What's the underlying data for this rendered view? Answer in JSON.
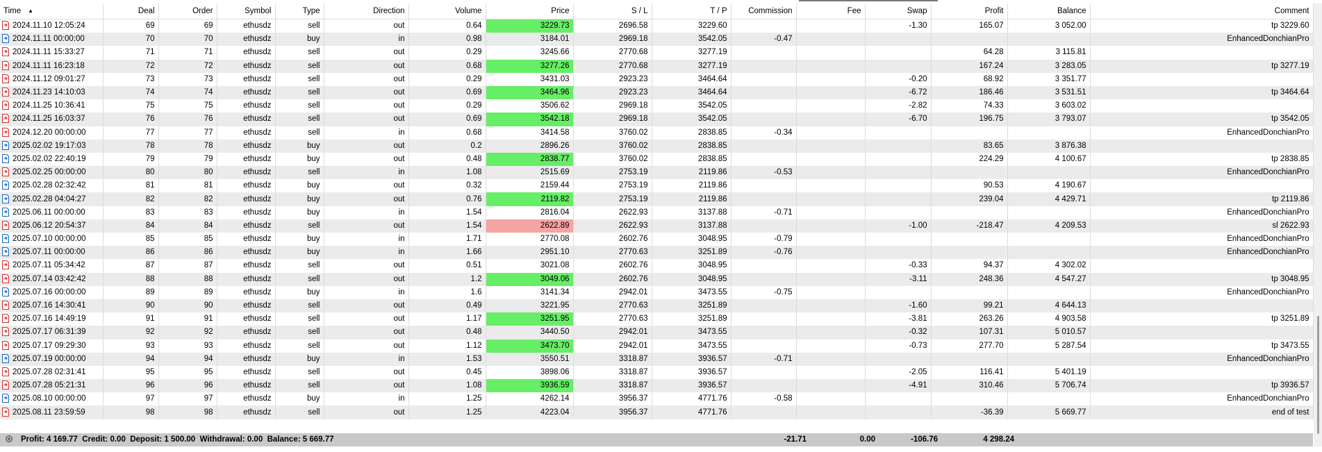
{
  "columns": [
    {
      "label": "Time",
      "w": 148,
      "align": "left"
    },
    {
      "label": "Deal",
      "w": 80
    },
    {
      "label": "Order",
      "w": 84
    },
    {
      "label": "Symbol",
      "w": 84
    },
    {
      "label": "Type",
      "w": 70
    },
    {
      "label": "Direction",
      "w": 122
    },
    {
      "label": "Volume",
      "w": 111
    },
    {
      "label": "Price",
      "w": 126
    },
    {
      "label": "S / L",
      "w": 113
    },
    {
      "label": "T / P",
      "w": 114
    },
    {
      "label": "Commission",
      "w": 94
    },
    {
      "label": "Fee",
      "w": 99
    },
    {
      "label": "Swap",
      "w": 95
    },
    {
      "label": "Profit",
      "w": 110
    },
    {
      "label": "Balance",
      "w": 119
    },
    {
      "label": "Comment",
      "w": 321
    }
  ],
  "rows": [
    {
      "icon": "sell",
      "time": "2024.11.10 12:05:24",
      "deal": "69",
      "order": "69",
      "symbol": "ethusdz",
      "type": "sell",
      "direction": "out",
      "volume": "0.64",
      "price": "3229.73",
      "price_hl": "green",
      "sl": "2696.58",
      "tp": "3229.60",
      "commission": "",
      "fee": "",
      "swap": "-1.30",
      "profit": "165.07",
      "balance": "3 052.00",
      "comment": "tp 3229.60"
    },
    {
      "icon": "buy",
      "time": "2024.11.11 00:00:00",
      "deal": "70",
      "order": "70",
      "symbol": "ethusdz",
      "type": "buy",
      "direction": "in",
      "volume": "0.98",
      "price": "3184.01",
      "price_hl": "",
      "sl": "2969.18",
      "tp": "3542.05",
      "commission": "-0.47",
      "fee": "",
      "swap": "",
      "profit": "",
      "balance": "",
      "comment": "EnhancedDonchianPro"
    },
    {
      "icon": "sell",
      "time": "2024.11.11 15:33:27",
      "deal": "71",
      "order": "71",
      "symbol": "ethusdz",
      "type": "sell",
      "direction": "out",
      "volume": "0.29",
      "price": "3245.66",
      "price_hl": "",
      "sl": "2770.68",
      "tp": "3277.19",
      "commission": "",
      "fee": "",
      "swap": "",
      "profit": "64.28",
      "balance": "3 115.81",
      "comment": ""
    },
    {
      "icon": "sell",
      "time": "2024.11.11 16:23:18",
      "deal": "72",
      "order": "72",
      "symbol": "ethusdz",
      "type": "sell",
      "direction": "out",
      "volume": "0.68",
      "price": "3277.26",
      "price_hl": "green",
      "sl": "2770.68",
      "tp": "3277.19",
      "commission": "",
      "fee": "",
      "swap": "",
      "profit": "167.24",
      "balance": "3 283.05",
      "comment": "tp 3277.19"
    },
    {
      "icon": "sell",
      "time": "2024.11.12 09:01:27",
      "deal": "73",
      "order": "73",
      "symbol": "ethusdz",
      "type": "sell",
      "direction": "out",
      "volume": "0.29",
      "price": "3431.03",
      "price_hl": "",
      "sl": "2923.23",
      "tp": "3464.64",
      "commission": "",
      "fee": "",
      "swap": "-0.20",
      "profit": "68.92",
      "balance": "3 351.77",
      "comment": ""
    },
    {
      "icon": "sell",
      "time": "2024.11.23 14:10:03",
      "deal": "74",
      "order": "74",
      "symbol": "ethusdz",
      "type": "sell",
      "direction": "out",
      "volume": "0.69",
      "price": "3464.96",
      "price_hl": "green",
      "sl": "2923.23",
      "tp": "3464.64",
      "commission": "",
      "fee": "",
      "swap": "-6.72",
      "profit": "186.46",
      "balance": "3 531.51",
      "comment": "tp 3464.64"
    },
    {
      "icon": "sell",
      "time": "2024.11.25 10:36:41",
      "deal": "75",
      "order": "75",
      "symbol": "ethusdz",
      "type": "sell",
      "direction": "out",
      "volume": "0.29",
      "price": "3506.62",
      "price_hl": "",
      "sl": "2969.18",
      "tp": "3542.05",
      "commission": "",
      "fee": "",
      "swap": "-2.82",
      "profit": "74.33",
      "balance": "3 603.02",
      "comment": ""
    },
    {
      "icon": "sell",
      "time": "2024.11.25 16:03:37",
      "deal": "76",
      "order": "76",
      "symbol": "ethusdz",
      "type": "sell",
      "direction": "out",
      "volume": "0.69",
      "price": "3542.18",
      "price_hl": "green",
      "sl": "2969.18",
      "tp": "3542.05",
      "commission": "",
      "fee": "",
      "swap": "-6.70",
      "profit": "196.75",
      "balance": "3 793.07",
      "comment": "tp 3542.05"
    },
    {
      "icon": "sell",
      "time": "2024.12.20 00:00:00",
      "deal": "77",
      "order": "77",
      "symbol": "ethusdz",
      "type": "sell",
      "direction": "in",
      "volume": "0.68",
      "price": "3414.58",
      "price_hl": "",
      "sl": "3760.02",
      "tp": "2838.85",
      "commission": "-0.34",
      "fee": "",
      "swap": "",
      "profit": "",
      "balance": "",
      "comment": "EnhancedDonchianPro"
    },
    {
      "icon": "buy",
      "time": "2025.02.02 19:17:03",
      "deal": "78",
      "order": "78",
      "symbol": "ethusdz",
      "type": "buy",
      "direction": "out",
      "volume": "0.2",
      "price": "2896.26",
      "price_hl": "",
      "sl": "3760.02",
      "tp": "2838.85",
      "commission": "",
      "fee": "",
      "swap": "",
      "profit": "83.65",
      "balance": "3 876.38",
      "comment": ""
    },
    {
      "icon": "buy",
      "time": "2025.02.02 22:40:19",
      "deal": "79",
      "order": "79",
      "symbol": "ethusdz",
      "type": "buy",
      "direction": "out",
      "volume": "0.48",
      "price": "2838.77",
      "price_hl": "green",
      "sl": "3760.02",
      "tp": "2838.85",
      "commission": "",
      "fee": "",
      "swap": "",
      "profit": "224.29",
      "balance": "4 100.67",
      "comment": "tp 2838.85"
    },
    {
      "icon": "sell",
      "time": "2025.02.25 00:00:00",
      "deal": "80",
      "order": "80",
      "symbol": "ethusdz",
      "type": "sell",
      "direction": "in",
      "volume": "1.08",
      "price": "2515.69",
      "price_hl": "",
      "sl": "2753.19",
      "tp": "2119.86",
      "commission": "-0.53",
      "fee": "",
      "swap": "",
      "profit": "",
      "balance": "",
      "comment": "EnhancedDonchianPro"
    },
    {
      "icon": "buy",
      "time": "2025.02.28 02:32:42",
      "deal": "81",
      "order": "81",
      "symbol": "ethusdz",
      "type": "buy",
      "direction": "out",
      "volume": "0.32",
      "price": "2159.44",
      "price_hl": "",
      "sl": "2753.19",
      "tp": "2119.86",
      "commission": "",
      "fee": "",
      "swap": "",
      "profit": "90.53",
      "balance": "4 190.67",
      "comment": ""
    },
    {
      "icon": "buy",
      "time": "2025.02.28 04:04:27",
      "deal": "82",
      "order": "82",
      "symbol": "ethusdz",
      "type": "buy",
      "direction": "out",
      "volume": "0.76",
      "price": "2119.82",
      "price_hl": "green",
      "sl": "2753.19",
      "tp": "2119.86",
      "commission": "",
      "fee": "",
      "swap": "",
      "profit": "239.04",
      "balance": "4 429.71",
      "comment": "tp 2119.86"
    },
    {
      "icon": "buy",
      "time": "2025.06.11 00:00:00",
      "deal": "83",
      "order": "83",
      "symbol": "ethusdz",
      "type": "buy",
      "direction": "in",
      "volume": "1.54",
      "price": "2816.04",
      "price_hl": "",
      "sl": "2622.93",
      "tp": "3137.88",
      "commission": "-0.71",
      "fee": "",
      "swap": "",
      "profit": "",
      "balance": "",
      "comment": "EnhancedDonchianPro"
    },
    {
      "icon": "sell",
      "time": "2025.06.12 20:54:37",
      "deal": "84",
      "order": "84",
      "symbol": "ethusdz",
      "type": "sell",
      "direction": "out",
      "volume": "1.54",
      "price": "2622.89",
      "price_hl": "red",
      "sl": "2622.93",
      "tp": "3137.88",
      "commission": "",
      "fee": "",
      "swap": "-1.00",
      "profit": "-218.47",
      "balance": "4 209.53",
      "comment": "sl 2622.93"
    },
    {
      "icon": "buy",
      "time": "2025.07.10 00:00:00",
      "deal": "85",
      "order": "85",
      "symbol": "ethusdz",
      "type": "buy",
      "direction": "in",
      "volume": "1.71",
      "price": "2770.08",
      "price_hl": "",
      "sl": "2602.76",
      "tp": "3048.95",
      "commission": "-0.79",
      "fee": "",
      "swap": "",
      "profit": "",
      "balance": "",
      "comment": "EnhancedDonchianPro"
    },
    {
      "icon": "buy",
      "time": "2025.07.11 00:00:00",
      "deal": "86",
      "order": "86",
      "symbol": "ethusdz",
      "type": "buy",
      "direction": "in",
      "volume": "1.66",
      "price": "2951.10",
      "price_hl": "",
      "sl": "2770.63",
      "tp": "3251.89",
      "commission": "-0.76",
      "fee": "",
      "swap": "",
      "profit": "",
      "balance": "",
      "comment": "EnhancedDonchianPro"
    },
    {
      "icon": "sell",
      "time": "2025.07.11 05:34:42",
      "deal": "87",
      "order": "87",
      "symbol": "ethusdz",
      "type": "sell",
      "direction": "out",
      "volume": "0.51",
      "price": "3021.08",
      "price_hl": "",
      "sl": "2602.76",
      "tp": "3048.95",
      "commission": "",
      "fee": "",
      "swap": "-0.33",
      "profit": "94.37",
      "balance": "4 302.02",
      "comment": ""
    },
    {
      "icon": "sell",
      "time": "2025.07.14 03:42:42",
      "deal": "88",
      "order": "88",
      "symbol": "ethusdz",
      "type": "sell",
      "direction": "out",
      "volume": "1.2",
      "price": "3049.06",
      "price_hl": "green",
      "sl": "2602.76",
      "tp": "3048.95",
      "commission": "",
      "fee": "",
      "swap": "-3.11",
      "profit": "248.36",
      "balance": "4 547.27",
      "comment": "tp 3048.95"
    },
    {
      "icon": "buy",
      "time": "2025.07.16 00:00:00",
      "deal": "89",
      "order": "89",
      "symbol": "ethusdz",
      "type": "buy",
      "direction": "in",
      "volume": "1.6",
      "price": "3141.34",
      "price_hl": "",
      "sl": "2942.01",
      "tp": "3473.55",
      "commission": "-0.75",
      "fee": "",
      "swap": "",
      "profit": "",
      "balance": "",
      "comment": "EnhancedDonchianPro"
    },
    {
      "icon": "sell",
      "time": "2025.07.16 14:30:41",
      "deal": "90",
      "order": "90",
      "symbol": "ethusdz",
      "type": "sell",
      "direction": "out",
      "volume": "0.49",
      "price": "3221.95",
      "price_hl": "",
      "sl": "2770.63",
      "tp": "3251.89",
      "commission": "",
      "fee": "",
      "swap": "-1.60",
      "profit": "99.21",
      "balance": "4 644.13",
      "comment": ""
    },
    {
      "icon": "sell",
      "time": "2025.07.16 14:49:19",
      "deal": "91",
      "order": "91",
      "symbol": "ethusdz",
      "type": "sell",
      "direction": "out",
      "volume": "1.17",
      "price": "3251.95",
      "price_hl": "green",
      "sl": "2770.63",
      "tp": "3251.89",
      "commission": "",
      "fee": "",
      "swap": "-3.81",
      "profit": "263.26",
      "balance": "4 903.58",
      "comment": "tp 3251.89"
    },
    {
      "icon": "sell",
      "time": "2025.07.17 06:31:39",
      "deal": "92",
      "order": "92",
      "symbol": "ethusdz",
      "type": "sell",
      "direction": "out",
      "volume": "0.48",
      "price": "3440.50",
      "price_hl": "",
      "sl": "2942.01",
      "tp": "3473.55",
      "commission": "",
      "fee": "",
      "swap": "-0.32",
      "profit": "107.31",
      "balance": "5 010.57",
      "comment": ""
    },
    {
      "icon": "sell",
      "time": "2025.07.17 09:29:30",
      "deal": "93",
      "order": "93",
      "symbol": "ethusdz",
      "type": "sell",
      "direction": "out",
      "volume": "1.12",
      "price": "3473.70",
      "price_hl": "green",
      "sl": "2942.01",
      "tp": "3473.55",
      "commission": "",
      "fee": "",
      "swap": "-0.73",
      "profit": "277.70",
      "balance": "5 287.54",
      "comment": "tp 3473.55"
    },
    {
      "icon": "buy",
      "time": "2025.07.19 00:00:00",
      "deal": "94",
      "order": "94",
      "symbol": "ethusdz",
      "type": "buy",
      "direction": "in",
      "volume": "1.53",
      "price": "3550.51",
      "price_hl": "",
      "sl": "3318.87",
      "tp": "3936.57",
      "commission": "-0.71",
      "fee": "",
      "swap": "",
      "profit": "",
      "balance": "",
      "comment": "EnhancedDonchianPro"
    },
    {
      "icon": "sell",
      "time": "2025.07.28 02:31:41",
      "deal": "95",
      "order": "95",
      "symbol": "ethusdz",
      "type": "sell",
      "direction": "out",
      "volume": "0.45",
      "price": "3898.06",
      "price_hl": "",
      "sl": "3318.87",
      "tp": "3936.57",
      "commission": "",
      "fee": "",
      "swap": "-2.05",
      "profit": "116.41",
      "balance": "5 401.19",
      "comment": ""
    },
    {
      "icon": "sell",
      "time": "2025.07.28 05:21:31",
      "deal": "96",
      "order": "96",
      "symbol": "ethusdz",
      "type": "sell",
      "direction": "out",
      "volume": "1.08",
      "price": "3936.59",
      "price_hl": "green",
      "sl": "3318.87",
      "tp": "3936.57",
      "commission": "",
      "fee": "",
      "swap": "-4.91",
      "profit": "310.46",
      "balance": "5 706.74",
      "comment": "tp 3936.57"
    },
    {
      "icon": "buy",
      "time": "2025.08.10 00:00:00",
      "deal": "97",
      "order": "97",
      "symbol": "ethusdz",
      "type": "buy",
      "direction": "in",
      "volume": "1.25",
      "price": "4262.14",
      "price_hl": "",
      "sl": "3956.37",
      "tp": "4771.76",
      "commission": "-0.58",
      "fee": "",
      "swap": "",
      "profit": "",
      "balance": "",
      "comment": "EnhancedDonchianPro"
    },
    {
      "icon": "sell",
      "time": "2025.08.11 23:59:59",
      "deal": "98",
      "order": "98",
      "symbol": "ethusdz",
      "type": "sell",
      "direction": "out",
      "volume": "1.25",
      "price": "4223.04",
      "price_hl": "",
      "sl": "3956.37",
      "tp": "4771.76",
      "commission": "",
      "fee": "",
      "swap": "",
      "profit": "-36.39",
      "balance": "5 669.77",
      "comment": "end of test"
    }
  ],
  "summary": {
    "text": "Profit: 4 169.77  Credit: 0.00  Deposit: 1 500.00  Withdrawal: 0.00  Balance: 5 669.77",
    "commission": "-21.71",
    "fee": "0.00",
    "swap": "-106.76",
    "profit": "4 298.24"
  },
  "colors": {
    "green": "#66ee66",
    "red": "#f5a3a3",
    "sell_icon": "#d32f2f",
    "buy_icon": "#1565c0"
  }
}
